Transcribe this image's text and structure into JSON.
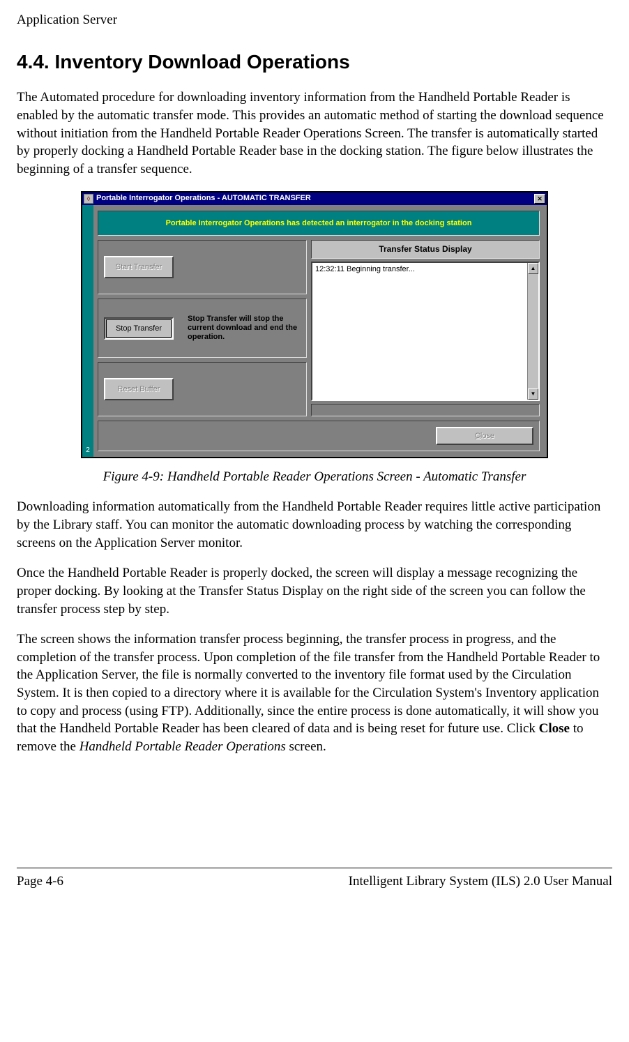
{
  "page_header": "Application Server",
  "section_title": "4.4.  Inventory Download Operations",
  "para1": "The Automated procedure for downloading inventory information from the Handheld Portable Reader is enabled by the automatic transfer mode. This provides an automatic method of starting the download sequence without initiation from the Handheld Portable Reader Operations Screen. The transfer is automatically started by properly docking a Handheld Portable Reader base in the docking station. The figure below illustrates the beginning of a transfer sequence.",
  "dialog": {
    "title": "Portable Interrogator Operations  -  AUTOMATIC TRANSFER",
    "banner": "Portable Interrogator Operations has detected an interrogator in the docking station",
    "buttons": {
      "start": "Start Transfer",
      "stop": "Stop Transfer",
      "stop_help": "Stop Transfer will stop the current download and end the operation.",
      "reset": "Reset Buffer",
      "close_prefix": "C",
      "close_rest": "lose"
    },
    "status_title": "Transfer Status Display",
    "status_lines": [
      "12:32:11 Beginning transfer..."
    ],
    "gutter_label": "2"
  },
  "figure_caption": "Figure 4-9: Handheld Portable Reader Operations Screen - Automatic Transfer",
  "para2": "Downloading information automatically from the Handheld Portable Reader requires little active participation by the Library staff. You can monitor the automatic downloading process by watching the corresponding screens on the Application Server monitor.",
  "para3": "Once the Handheld Portable Reader is properly docked, the screen will display a message recognizing the proper docking. By looking at the Transfer Status Display on the right side of the screen you can follow the transfer process step by step.",
  "para4_a": "The screen shows the information transfer process beginning, the transfer process in progress, and the completion of the transfer process. Upon completion of the file transfer from the Handheld Portable Reader to the Application Server, the file is normally converted to the inventory file format used by the Circulation System. It is then copied to a directory where it is available for the Circulation System's Inventory application to copy and process (using FTP). Additionally, since the entire process is done automatically, it will show you that the Handheld Portable Reader has been cleared of data and is being reset for future use. Click ",
  "para4_bold": "Close",
  "para4_b": " to remove the ",
  "para4_italic": "Handheld Portable Reader Operations",
  "para4_c": " screen.",
  "footer_left": "Page 4-6",
  "footer_right": "Intelligent Library System (ILS) 2.0 User Manual"
}
